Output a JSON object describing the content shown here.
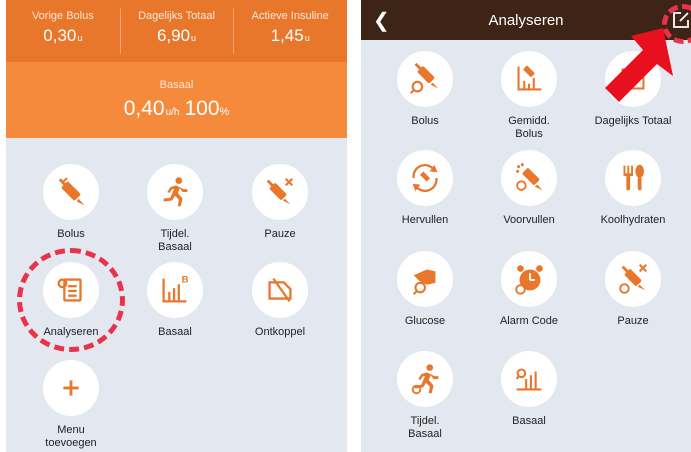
{
  "left_screen": {
    "stats": [
      {
        "label": "Vorige Bolus",
        "value": "0,30",
        "unit": "u"
      },
      {
        "label": "Dagelijks Totaal",
        "value": "6,90",
        "unit": "u"
      },
      {
        "label": "Actieve Insuline",
        "value": "1,45",
        "unit": "u"
      }
    ],
    "basal": {
      "label": "Basaal",
      "value": "0,40",
      "unit": "u/h",
      "percent": "100",
      "percent_unit": "%"
    },
    "menu": [
      {
        "label": "Bolus",
        "icon": "syringe-icon"
      },
      {
        "label": "Tijdel.\nBasaal",
        "icon": "running-person-icon"
      },
      {
        "label": "Pauze",
        "icon": "syringe-pause-icon"
      },
      {
        "label": "Analyseren",
        "icon": "report-icon"
      },
      {
        "label": "Basaal",
        "icon": "basal-chart-icon"
      },
      {
        "label": "Ontkoppel",
        "icon": "disconnect-icon"
      },
      {
        "label": "Menu\ntoevoegen",
        "icon": "plus-icon"
      }
    ]
  },
  "right_screen": {
    "title": "Analyseren",
    "back_icon": "chevron-left-icon",
    "edit_icon": "edit-icon",
    "items": [
      {
        "label": "Bolus",
        "icon": "syringe-search-icon"
      },
      {
        "label": "Gemidd.\nBolus",
        "icon": "average-chart-icon"
      },
      {
        "label": "Dagelijks Totaal",
        "icon": "daily-total-icon"
      },
      {
        "label": "Hervullen",
        "icon": "refill-icon"
      },
      {
        "label": "Voorvullen",
        "icon": "prime-icon"
      },
      {
        "label": "Koolhydraten",
        "icon": "carbs-icon"
      },
      {
        "label": "Glucose",
        "icon": "glucose-icon"
      },
      {
        "label": "Alarm Code",
        "icon": "alarm-icon"
      },
      {
        "label": "Pauze",
        "icon": "syringe-pause-icon"
      },
      {
        "label": "Tijdel.\nBasaal",
        "icon": "running-person-icon"
      },
      {
        "label": "Basaal",
        "icon": "basal-search-icon"
      }
    ]
  },
  "colors": {
    "orange_dark": "#e8772c",
    "orange": "#f58a3c",
    "icon_orange": "#e8772c",
    "title_bar": "#3d2416",
    "highlight_red": "#e8344a",
    "screen_bg": "#e3e7f0"
  }
}
